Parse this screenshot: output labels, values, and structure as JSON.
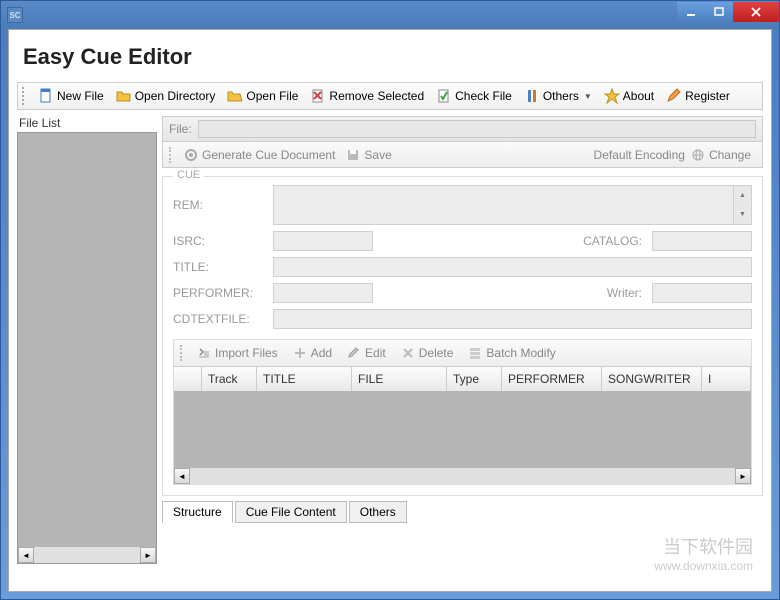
{
  "titlebar": {
    "app_icon_text": "SC",
    "title": ""
  },
  "header": {
    "title": "Easy Cue Editor"
  },
  "toolbar": {
    "new_file": "New File",
    "open_directory": "Open Directory",
    "open_file": "Open File",
    "remove_selected": "Remove Selected",
    "check_file": "Check File",
    "others": "Others",
    "about": "About",
    "register": "Register"
  },
  "filelist": {
    "label": "File List"
  },
  "file_row": {
    "label": "File:",
    "value": ""
  },
  "sec_toolbar": {
    "generate": "Generate Cue Document",
    "save": "Save",
    "default_encoding": "Default Encoding",
    "change": "Change"
  },
  "cue": {
    "legend": "CUE",
    "rem_label": "REM:",
    "rem_value": "",
    "isrc_label": "ISRC:",
    "isrc_value": "",
    "catalog_label": "CATALOG:",
    "catalog_value": "",
    "title_label": "TITLE:",
    "title_value": "",
    "performer_label": "PERFORMER:",
    "performer_value": "",
    "writer_label": "Writer:",
    "writer_value": "",
    "cdtextfile_label": "CDTEXTFILE:",
    "cdtextfile_value": ""
  },
  "track_toolbar": {
    "import_files": "Import Files",
    "add": "Add",
    "edit": "Edit",
    "delete": "Delete",
    "batch_modify": "Batch Modify"
  },
  "track_columns": [
    "",
    "Track",
    "TITLE",
    "FILE",
    "Type",
    "PERFORMER",
    "SONGWRITER",
    "I"
  ],
  "tabs": {
    "structure": "Structure",
    "cue_file_content": "Cue File Content",
    "others": "Others"
  },
  "watermark": {
    "line1": "当下软件园",
    "line2": "www.downxia.com"
  }
}
